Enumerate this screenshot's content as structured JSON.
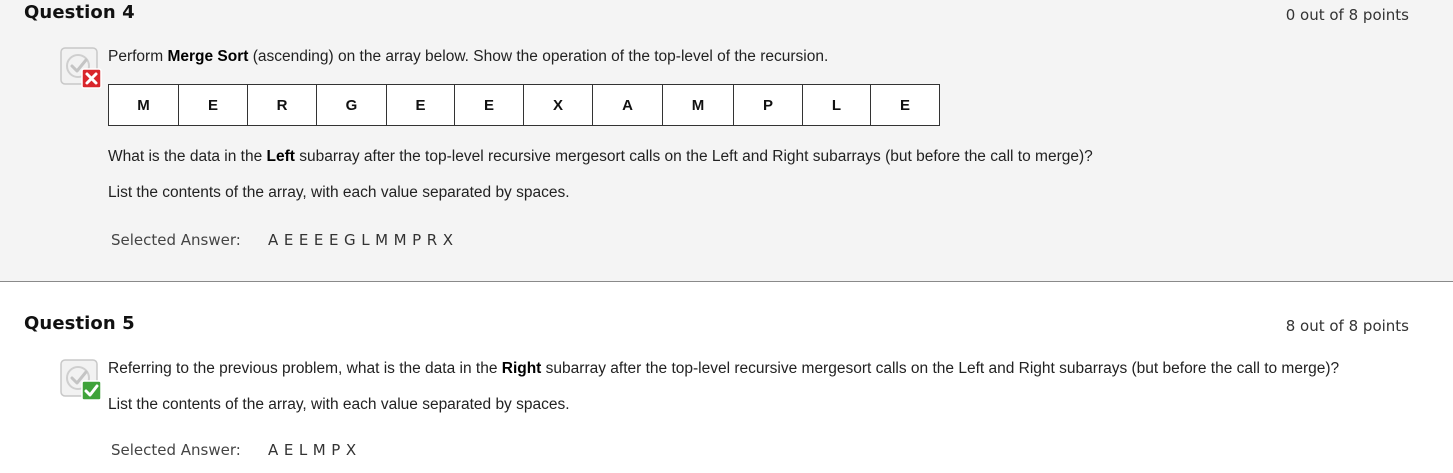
{
  "questions": [
    {
      "title": "Question 4",
      "points": "0 out of 8 points",
      "status": "incorrect",
      "prompt": {
        "pre": "Perform ",
        "bold": "Merge Sort",
        "post": " (ascending) on the array below. Show the operation of the top-level of the recursion."
      },
      "array": [
        "M",
        "E",
        "R",
        "G",
        "E",
        "E",
        "X",
        "A",
        "M",
        "P",
        "L",
        "E"
      ],
      "question_line": {
        "pre": "What is the data in the ",
        "bold": "Left",
        "post": " subarray after the top-level recursive mergesort calls on the Left and Right subarrays (but before the call to merge)?"
      },
      "instruction": "List the contents of the array, with each value separated by spaces.",
      "selected_label": "Selected Answer:",
      "selected_value": "A E E E E G L M M P R X"
    },
    {
      "title": "Question 5",
      "points": "8 out of 8 points",
      "status": "correct",
      "question_line": {
        "pre": "Referring to the previous problem, what is the data in the ",
        "bold": "Right",
        "post": " subarray after the top-level recursive mergesort calls on the Left and Right subarrays (but before the call to merge)?"
      },
      "instruction": "List the contents of the array, with each value separated by spaces.",
      "selected_label": "Selected Answer:",
      "selected_value": "A E L M P X"
    }
  ],
  "colors": {
    "incorrect_badge": "#d9262c",
    "correct_badge": "#3fa33a",
    "panel_bg": "#f4f4f4"
  },
  "icons": {
    "incorrect": "clipboard-check-icon with red x badge",
    "correct": "clipboard-check-icon with green check badge"
  }
}
